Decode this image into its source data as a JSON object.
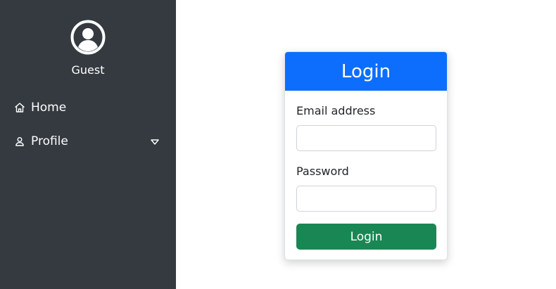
{
  "sidebar": {
    "user_name": "Guest",
    "items": [
      {
        "label": "Home",
        "icon": "home-icon"
      },
      {
        "label": "Profile",
        "icon": "user-icon"
      }
    ]
  },
  "login_card": {
    "title": "Login",
    "email_label": "Email address",
    "email_value": "",
    "email_placeholder": "",
    "password_label": "Password",
    "password_value": "",
    "password_placeholder": "",
    "button_label": "Login"
  },
  "colors": {
    "sidebar_bg": "#343a40",
    "header_bg": "#0d6efd",
    "button_bg": "#198754"
  }
}
